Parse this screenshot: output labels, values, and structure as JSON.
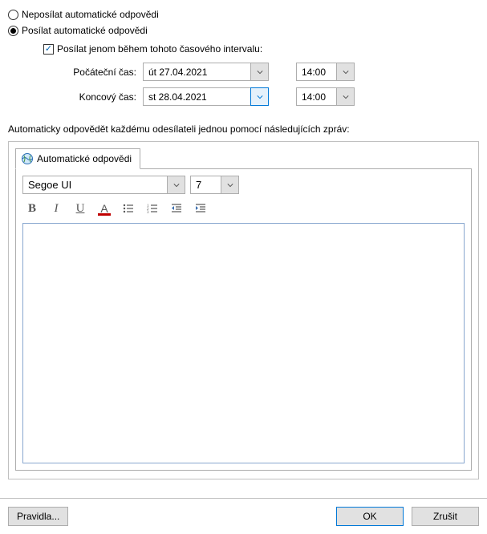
{
  "radios": {
    "do_not_send": "Neposílat automatické odpovědi",
    "send": "Posílat automatické odpovědi",
    "selected": "send"
  },
  "checkbox": {
    "label": "Posílat jenom během tohoto časového intervalu:",
    "checked": true
  },
  "time_range": {
    "start_label": "Počáteční čas:",
    "end_label": "Koncový čas:",
    "start_date": "út 27.04.2021",
    "end_date": "st 28.04.2021",
    "start_time": "14:00",
    "end_time": "14:00"
  },
  "instruction": "Automaticky odpovědět každému odesílateli jednou pomocí následujících zpráv:",
  "tab": {
    "label": "Automatické odpovědi"
  },
  "editor": {
    "font_name": "Segoe UI",
    "font_size": "7",
    "body": ""
  },
  "buttons": {
    "rules": "Pravidla...",
    "ok": "OK",
    "cancel": "Zrušit"
  }
}
